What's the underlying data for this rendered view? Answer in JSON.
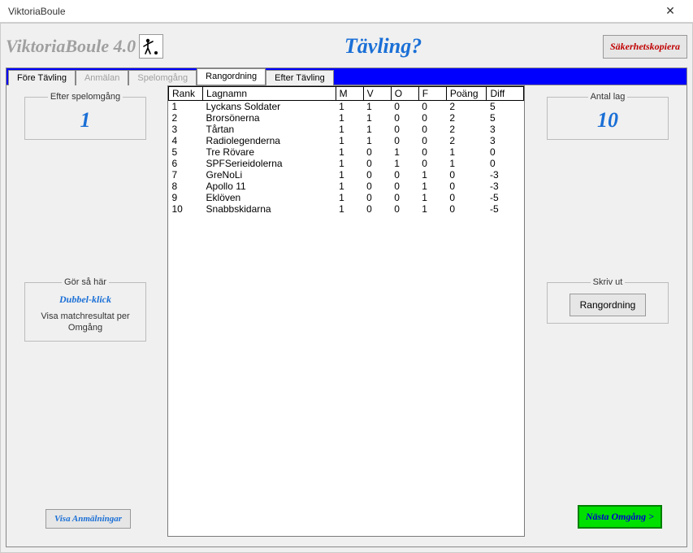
{
  "window": {
    "title": "ViktoriaBoule"
  },
  "header": {
    "app_name": "ViktoriaBoule 4.0",
    "center_title": "Tävling?",
    "backup_label": "Säkerhetskopiera"
  },
  "tabs": [
    {
      "label": "Före Tävling",
      "active": false,
      "disabled": false
    },
    {
      "label": "Anmälan",
      "active": false,
      "disabled": true
    },
    {
      "label": "Spelomgång",
      "active": false,
      "disabled": true
    },
    {
      "label": "Rangordning",
      "active": true,
      "disabled": false
    },
    {
      "label": "Efter Tävling",
      "active": false,
      "disabled": false
    }
  ],
  "left": {
    "round_legend": "Efter spelomgång",
    "round_value": "1",
    "howto_legend": "Gör så här",
    "howto_title": "Dubbel-klick",
    "howto_text": "Visa matchresultat per Omgång",
    "show_regs_label": "Visa Anmälningar"
  },
  "right": {
    "count_legend": "Antal lag",
    "count_value": "10",
    "print_legend": "Skriv ut",
    "print_btn_label": "Rangordning",
    "next_btn_label": "Nästa Omgång >"
  },
  "table": {
    "headers": {
      "rank": "Rank",
      "name": "Lagnamn",
      "m": "M",
      "v": "V",
      "o": "O",
      "f": "F",
      "poang": "Poäng",
      "diff": "Diff"
    },
    "rows": [
      {
        "rank": "1",
        "name": "Lyckans Soldater",
        "m": "1",
        "v": "1",
        "o": "0",
        "f": "0",
        "poang": "2",
        "diff": "5"
      },
      {
        "rank": "2",
        "name": "Brorsönerna",
        "m": "1",
        "v": "1",
        "o": "0",
        "f": "0",
        "poang": "2",
        "diff": "5"
      },
      {
        "rank": "3",
        "name": "Tårtan",
        "m": "1",
        "v": "1",
        "o": "0",
        "f": "0",
        "poang": "2",
        "diff": "3"
      },
      {
        "rank": "4",
        "name": "Radiolegenderna",
        "m": "1",
        "v": "1",
        "o": "0",
        "f": "0",
        "poang": "2",
        "diff": "3"
      },
      {
        "rank": "5",
        "name": "Tre Rövare",
        "m": "1",
        "v": "0",
        "o": "1",
        "f": "0",
        "poang": "1",
        "diff": "0"
      },
      {
        "rank": "6",
        "name": "SPFSerieidolerna",
        "m": "1",
        "v": "0",
        "o": "1",
        "f": "0",
        "poang": "1",
        "diff": "0"
      },
      {
        "rank": "7",
        "name": "GreNoLi",
        "m": "1",
        "v": "0",
        "o": "0",
        "f": "1",
        "poang": "0",
        "diff": "-3"
      },
      {
        "rank": "8",
        "name": "Apollo 11",
        "m": "1",
        "v": "0",
        "o": "0",
        "f": "1",
        "poang": "0",
        "diff": "-3"
      },
      {
        "rank": "9",
        "name": "Eklöven",
        "m": "1",
        "v": "0",
        "o": "0",
        "f": "1",
        "poang": "0",
        "diff": "-5"
      },
      {
        "rank": "10",
        "name": "Snabbskidarna",
        "m": "1",
        "v": "0",
        "o": "0",
        "f": "1",
        "poang": "0",
        "diff": "-5"
      }
    ]
  }
}
